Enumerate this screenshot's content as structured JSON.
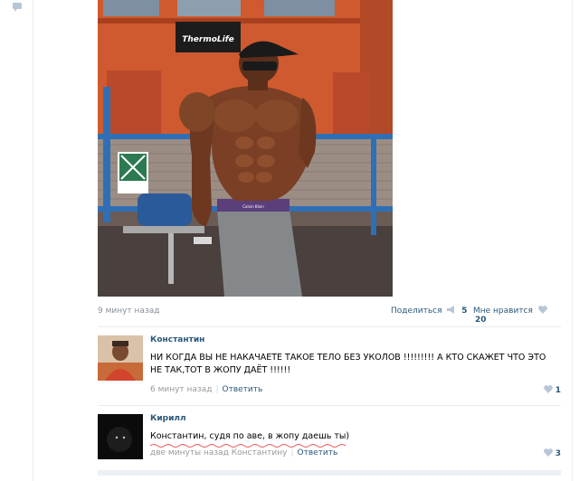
{
  "post": {
    "time": "9 минут назад",
    "share_label": "Поделиться",
    "share_count": "5",
    "like_label": "Мне нравится",
    "like_count": "20",
    "photo": {
      "sign_text": "ThermoLife",
      "shorts_text": "Calvin Klein"
    }
  },
  "comments": [
    {
      "author": "Константин",
      "text": "НИ КОГДА ВЫ НЕ НАКАЧАЕТЕ ТАКОЕ ТЕЛО БЕЗ УКОЛОВ !!!!!!!!! А КТО СКАЖЕТ ЧТО ЭТО НЕ ТАК,ТОТ В ЖОПУ ДАЁТ !!!!!!",
      "time": "6 минут назад",
      "reply_label": "Ответить",
      "likes": "1"
    },
    {
      "author": "Кирилл",
      "text": "Константин, судя по аве, в жопу даешь ты)",
      "time": "две минуты назад",
      "reply_to": "Константину",
      "reply_label": "Ответить",
      "likes": "3"
    }
  ],
  "colors": {
    "link": "#2b587a",
    "muted": "#888f98",
    "border": "#e7ebf0",
    "heart": "#b7c6d7",
    "underline": "#e8575a"
  }
}
